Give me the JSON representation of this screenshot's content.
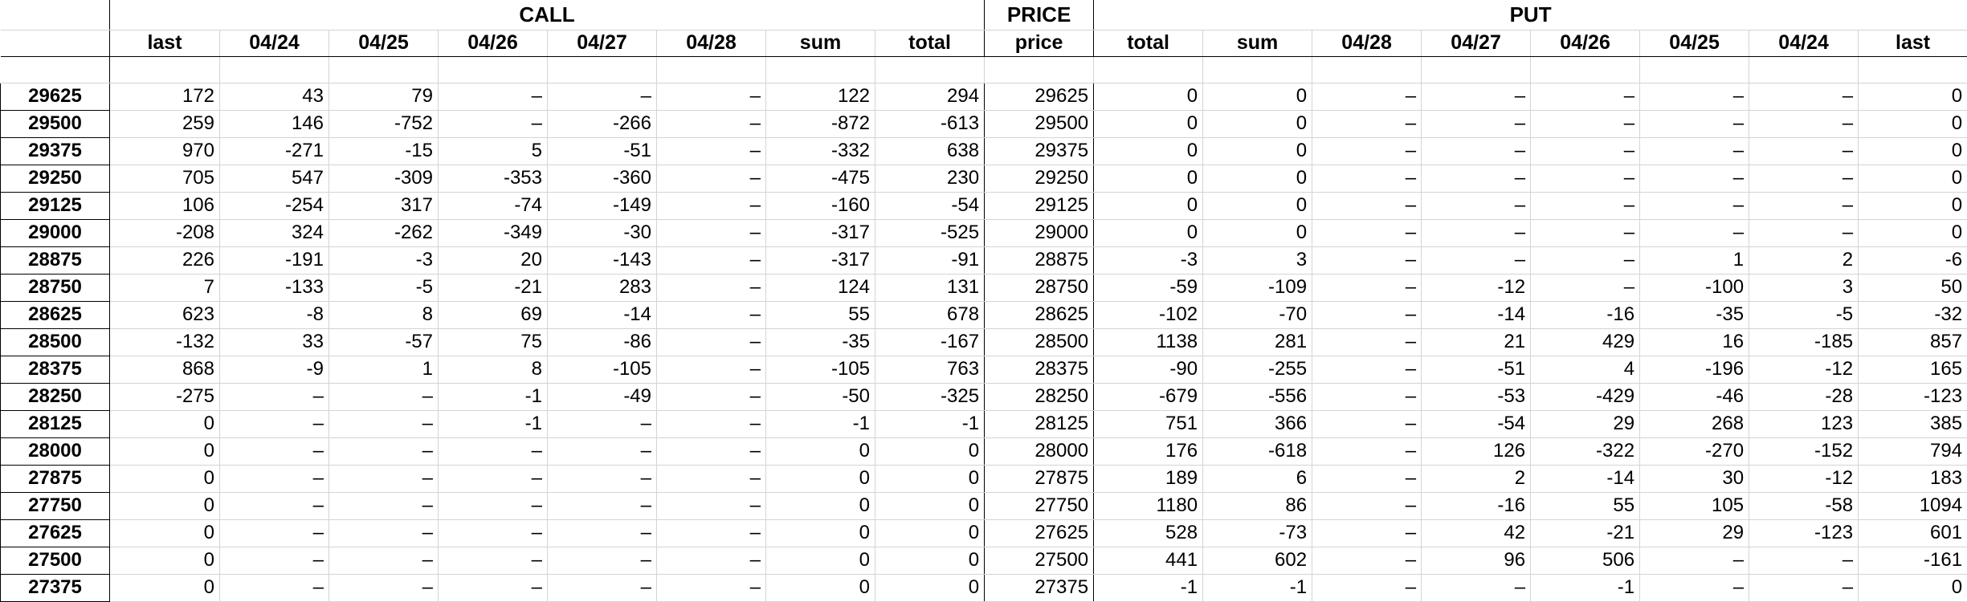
{
  "sections": {
    "call": "CALL",
    "price": "PRICE",
    "put": "PUT"
  },
  "columns": [
    "last",
    "04/24",
    "04/25",
    "04/26",
    "04/27",
    "04/28",
    "sum",
    "total",
    "price",
    "total",
    "sum",
    "04/28",
    "04/27",
    "04/26",
    "04/25",
    "04/24",
    "last"
  ],
  "rows": [
    {
      "key": "29625",
      "cells": [
        "172",
        "43",
        "79",
        "–",
        "–",
        "–",
        "122",
        "294",
        "29625",
        "0",
        "0",
        "–",
        "–",
        "–",
        "–",
        "–",
        "0"
      ]
    },
    {
      "key": "29500",
      "cells": [
        "259",
        "146",
        "-752",
        "–",
        "-266",
        "–",
        "-872",
        "-613",
        "29500",
        "0",
        "0",
        "–",
        "–",
        "–",
        "–",
        "–",
        "0"
      ]
    },
    {
      "key": "29375",
      "cells": [
        "970",
        "-271",
        "-15",
        "5",
        "-51",
        "–",
        "-332",
        "638",
        "29375",
        "0",
        "0",
        "–",
        "–",
        "–",
        "–",
        "–",
        "0"
      ]
    },
    {
      "key": "29250",
      "cells": [
        "705",
        "547",
        "-309",
        "-353",
        "-360",
        "–",
        "-475",
        "230",
        "29250",
        "0",
        "0",
        "–",
        "–",
        "–",
        "–",
        "–",
        "0"
      ]
    },
    {
      "key": "29125",
      "cells": [
        "106",
        "-254",
        "317",
        "-74",
        "-149",
        "–",
        "-160",
        "-54",
        "29125",
        "0",
        "0",
        "–",
        "–",
        "–",
        "–",
        "–",
        "0"
      ]
    },
    {
      "key": "29000",
      "cells": [
        "-208",
        "324",
        "-262",
        "-349",
        "-30",
        "–",
        "-317",
        "-525",
        "29000",
        "0",
        "0",
        "–",
        "–",
        "–",
        "–",
        "–",
        "0"
      ]
    },
    {
      "key": "28875",
      "cells": [
        "226",
        "-191",
        "-3",
        "20",
        "-143",
        "–",
        "-317",
        "-91",
        "28875",
        "-3",
        "3",
        "–",
        "–",
        "–",
        "1",
        "2",
        "-6"
      ]
    },
    {
      "key": "28750",
      "cells": [
        "7",
        "-133",
        "-5",
        "-21",
        "283",
        "–",
        "124",
        "131",
        "28750",
        "-59",
        "-109",
        "–",
        "-12",
        "–",
        "-100",
        "3",
        "50"
      ]
    },
    {
      "key": "28625",
      "cells": [
        "623",
        "-8",
        "8",
        "69",
        "-14",
        "–",
        "55",
        "678",
        "28625",
        "-102",
        "-70",
        "–",
        "-14",
        "-16",
        "-35",
        "-5",
        "-32"
      ]
    },
    {
      "key": "28500",
      "cells": [
        "-132",
        "33",
        "-57",
        "75",
        "-86",
        "–",
        "-35",
        "-167",
        "28500",
        "1138",
        "281",
        "–",
        "21",
        "429",
        "16",
        "-185",
        "857"
      ]
    },
    {
      "key": "28375",
      "cells": [
        "868",
        "-9",
        "1",
        "8",
        "-105",
        "–",
        "-105",
        "763",
        "28375",
        "-90",
        "-255",
        "–",
        "-51",
        "4",
        "-196",
        "-12",
        "165"
      ]
    },
    {
      "key": "28250",
      "cells": [
        "-275",
        "–",
        "–",
        "-1",
        "-49",
        "–",
        "-50",
        "-325",
        "28250",
        "-679",
        "-556",
        "–",
        "-53",
        "-429",
        "-46",
        "-28",
        "-123"
      ]
    },
    {
      "key": "28125",
      "cells": [
        "0",
        "–",
        "–",
        "-1",
        "–",
        "–",
        "-1",
        "-1",
        "28125",
        "751",
        "366",
        "–",
        "-54",
        "29",
        "268",
        "123",
        "385"
      ]
    },
    {
      "key": "28000",
      "cells": [
        "0",
        "–",
        "–",
        "–",
        "–",
        "–",
        "0",
        "0",
        "28000",
        "176",
        "-618",
        "–",
        "126",
        "-322",
        "-270",
        "-152",
        "794"
      ]
    },
    {
      "key": "27875",
      "cells": [
        "0",
        "–",
        "–",
        "–",
        "–",
        "–",
        "0",
        "0",
        "27875",
        "189",
        "6",
        "–",
        "2",
        "-14",
        "30",
        "-12",
        "183"
      ]
    },
    {
      "key": "27750",
      "cells": [
        "0",
        "–",
        "–",
        "–",
        "–",
        "–",
        "0",
        "0",
        "27750",
        "1180",
        "86",
        "–",
        "-16",
        "55",
        "105",
        "-58",
        "1094"
      ]
    },
    {
      "key": "27625",
      "cells": [
        "0",
        "–",
        "–",
        "–",
        "–",
        "–",
        "0",
        "0",
        "27625",
        "528",
        "-73",
        "–",
        "42",
        "-21",
        "29",
        "-123",
        "601"
      ]
    },
    {
      "key": "27500",
      "cells": [
        "0",
        "–",
        "–",
        "–",
        "–",
        "–",
        "0",
        "0",
        "27500",
        "441",
        "602",
        "–",
        "96",
        "506",
        "–",
        "–",
        "-161"
      ]
    },
    {
      "key": "27375",
      "cells": [
        "0",
        "–",
        "–",
        "–",
        "–",
        "–",
        "0",
        "0",
        "27375",
        "-1",
        "-1",
        "–",
        "–",
        "-1",
        "–",
        "–",
        "0"
      ]
    }
  ]
}
